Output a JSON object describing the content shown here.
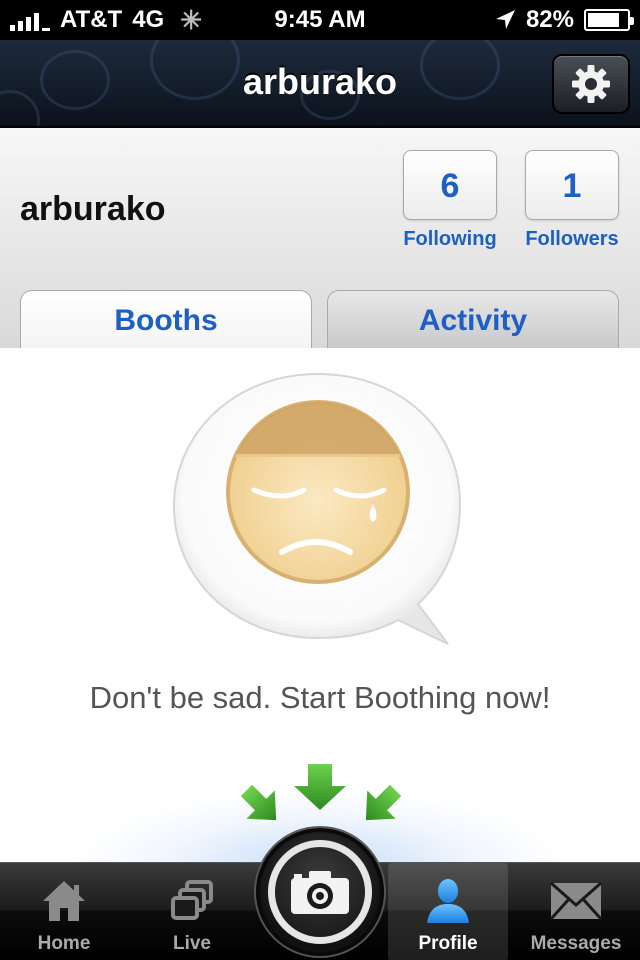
{
  "status_bar": {
    "carrier": "AT&T",
    "network": "4G",
    "time": "9:45 AM",
    "battery": "82%",
    "battery_level": 0.82
  },
  "nav": {
    "title": "arburako",
    "settings_icon": "gear-icon"
  },
  "profile": {
    "username": "arburako",
    "following_count": "6",
    "following_label": "Following",
    "followers_count": "1",
    "followers_label": "Followers"
  },
  "tabs": [
    {
      "label": "Booths",
      "selected": true
    },
    {
      "label": "Activity",
      "selected": false
    }
  ],
  "empty_state": {
    "icon": "sad-face-icon",
    "message": "Don't be sad. Start Boothing now!"
  },
  "tab_bar": {
    "items": [
      {
        "label": "Home",
        "icon": "home-icon"
      },
      {
        "label": "Live",
        "icon": "live-icon"
      },
      {
        "label": "Profile",
        "icon": "profile-icon",
        "selected": true
      },
      {
        "label": "Messages",
        "icon": "messages-icon"
      }
    ],
    "camera_icon": "camera-icon"
  },
  "colors": {
    "accent_blue": "#1d5fc4",
    "arrow_green": "#3aa02a",
    "face_fill": "#f4d9a2"
  }
}
